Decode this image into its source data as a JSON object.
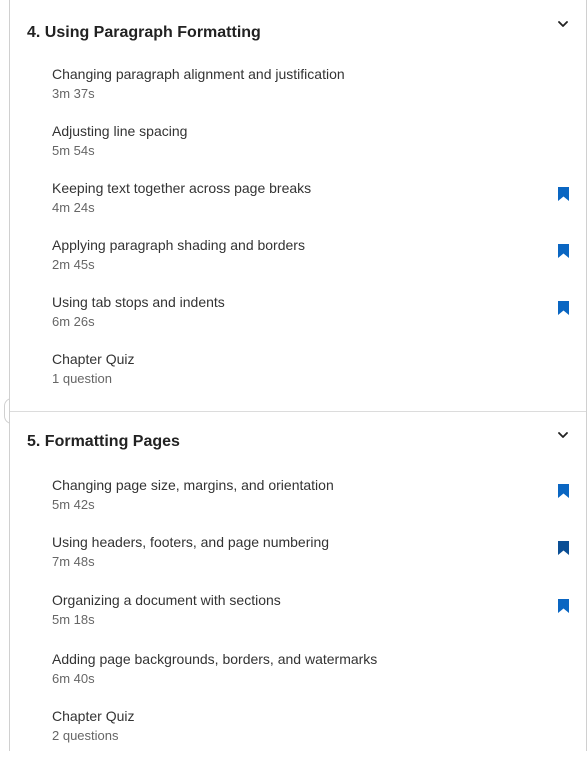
{
  "colors": {
    "bookmark": "#0a66c2",
    "bookmark_dark": "#0b4f95",
    "title": "#222222",
    "muted": "#666666"
  },
  "chapters": [
    {
      "title": "4. Using Paragraph Formatting",
      "collapse_icon": "chevron-down-icon",
      "items": [
        {
          "title": "Changing paragraph alignment and justification",
          "meta": "3m 37s",
          "bookmarked": false
        },
        {
          "title": "Adjusting line spacing",
          "meta": "5m 54s",
          "bookmarked": false
        },
        {
          "title": "Keeping text together across page breaks",
          "meta": "4m 24s",
          "bookmarked": true
        },
        {
          "title": "Applying paragraph shading and borders",
          "meta": "2m 45s",
          "bookmarked": true
        },
        {
          "title": "Using tab stops and indents",
          "meta": "6m 26s",
          "bookmarked": true
        },
        {
          "title": "Chapter Quiz",
          "meta": "1 question",
          "bookmarked": false
        }
      ]
    },
    {
      "title": "5. Formatting Pages",
      "collapse_icon": "chevron-down-icon",
      "items": [
        {
          "title": "Changing page size, margins, and orientation",
          "meta": "5m 42s",
          "bookmarked": true
        },
        {
          "title": "Using headers, footers, and page numbering",
          "meta": "7m 48s",
          "bookmarked": true
        },
        {
          "title": "Organizing a document with sections",
          "meta": "5m 18s",
          "bookmarked": true
        },
        {
          "title": "Adding page backgrounds, borders, and watermarks",
          "meta": "6m 40s",
          "bookmarked": false
        },
        {
          "title": "Chapter Quiz",
          "meta": "2 questions",
          "bookmarked": false
        }
      ]
    }
  ]
}
